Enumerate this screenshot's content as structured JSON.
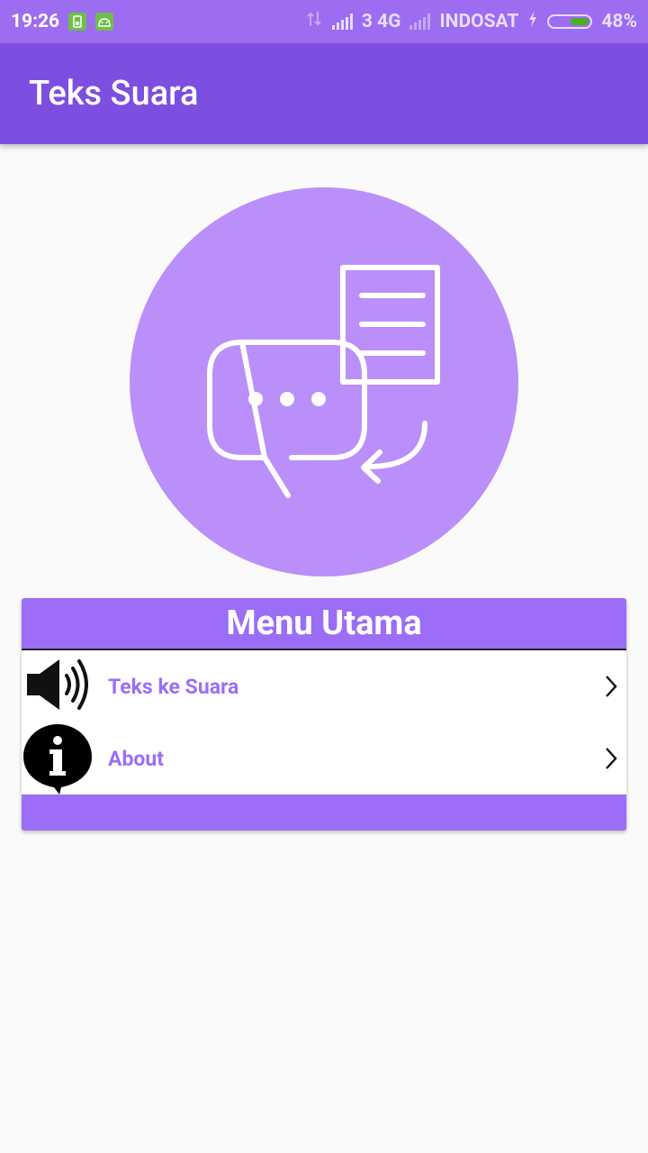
{
  "status_bar": {
    "time": "19:26",
    "network_label": "3 4G",
    "carrier": "INDOSAT",
    "battery_percent": "48%"
  },
  "app_bar": {
    "title": "Teks Suara"
  },
  "logo": {
    "icon": "chat-document-convert-icon"
  },
  "menu": {
    "title": "Menu Utama",
    "items": [
      {
        "label": "Teks ke Suara",
        "icon": "speaker-icon"
      },
      {
        "label": "About",
        "icon": "info-icon"
      }
    ]
  },
  "colors": {
    "status_bar": "#9c6df0",
    "app_bar": "#7d4fe0",
    "logo_circle": "#bb8ff9",
    "menu_accent": "#9c6df6",
    "background": "#fafafa"
  }
}
